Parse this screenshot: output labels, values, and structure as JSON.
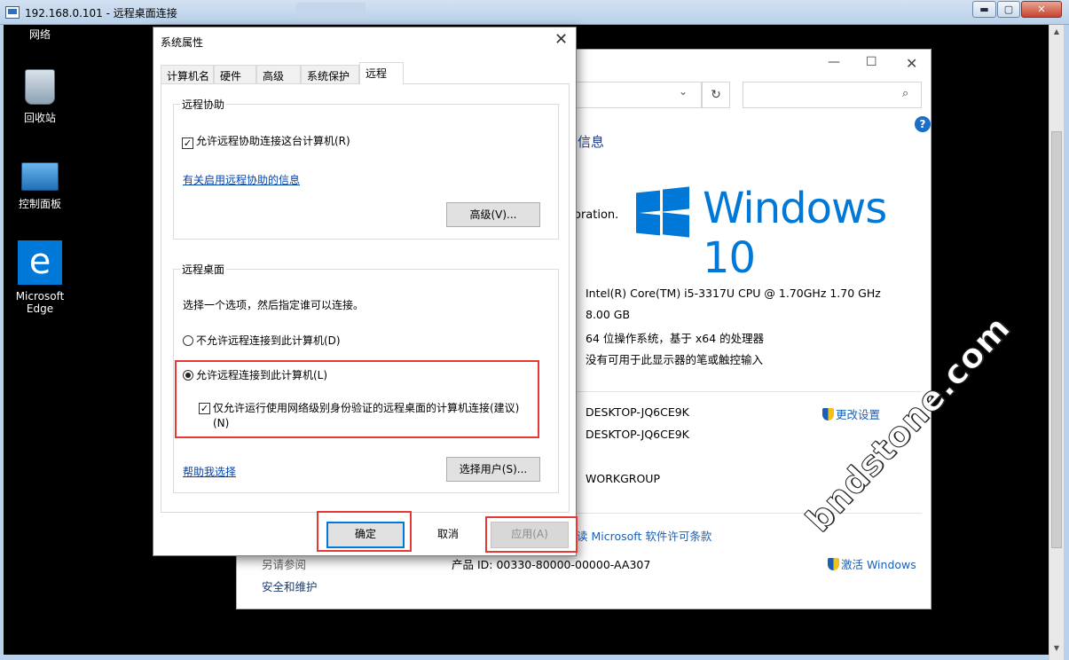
{
  "rdp": {
    "title": "192.168.0.101 - 远程桌面连接",
    "min_glyph": "▬",
    "max_glyph": "▢",
    "close_glyph": "✕"
  },
  "desktop_icons": {
    "network": "网络",
    "recycle_bin": "回收站",
    "control_panel": "控制面板",
    "edge": "Microsoft Edge",
    "edge_glyph": "e"
  },
  "system_window": {
    "min_glyph": "—",
    "max_glyph": "☐",
    "close_glyph": "✕",
    "refresh_glyph": "↻",
    "search_glyph": "⌕",
    "help_glyph": "?",
    "heading_fragment": "信息",
    "copyright_fragment": "oration.",
    "windows_brand": "Windows 10",
    "processor": "Intel(R) Core(TM) i5-3317U CPU @ 1.70GHz   1.70 GHz",
    "ram": "8.00 GB",
    "system_type": "64 位操作系统，基于 x64 的处理器",
    "pen_touch": "没有可用于此显示器的笔或触控输入",
    "computer_name": "DESKTOP-JQ6CE9K",
    "full_computer_name": "DESKTOP-JQ6CE9K",
    "workgroup": "WORKGROUP",
    "change_settings": "更改设置",
    "license_fragment": "读 Microsoft 软件许可条款",
    "see_also": "另请参阅",
    "security_maintenance": "安全和维护",
    "product_id": "产品 ID: 00330-80000-00000-AA307",
    "activate": "激活 Windows"
  },
  "dialog": {
    "title": "系统属性",
    "close_glyph": "✕",
    "tabs": [
      "计算机名",
      "硬件",
      "高级",
      "系统保护",
      "远程"
    ],
    "active_tab": "远程",
    "remote_assistance": {
      "group_title": "远程协助",
      "allow_label": "允许远程协助连接这台计算机(R)",
      "allow_checked": true,
      "info_link": "有关启用远程协助的信息",
      "advanced_button": "高级(V)..."
    },
    "remote_desktop": {
      "group_title": "远程桌面",
      "instruction": "选择一个选项，然后指定谁可以连接。",
      "option_deny": "不允许远程连接到此计算机(D)",
      "option_allow": "允许远程连接到此计算机(L)",
      "selected": "option_allow",
      "nla_label": "仅允许运行使用网络级别身份验证的远程桌面的计算机连接(建议)(N)",
      "nla_checked": true,
      "help_link": "帮助我选择",
      "select_users_button": "选择用户(S)..."
    },
    "ok_button": "确定",
    "cancel_button": "取消",
    "apply_button": "应用(A)",
    "checkmark_glyph": "✓"
  },
  "scrollbar": {
    "up_glyph": "▲",
    "down_glyph": "▼"
  },
  "watermark": "bndstone.com",
  "colors": {
    "highlight": "#e53935",
    "link": "#0645ad",
    "windows_blue": "#0078d7"
  }
}
